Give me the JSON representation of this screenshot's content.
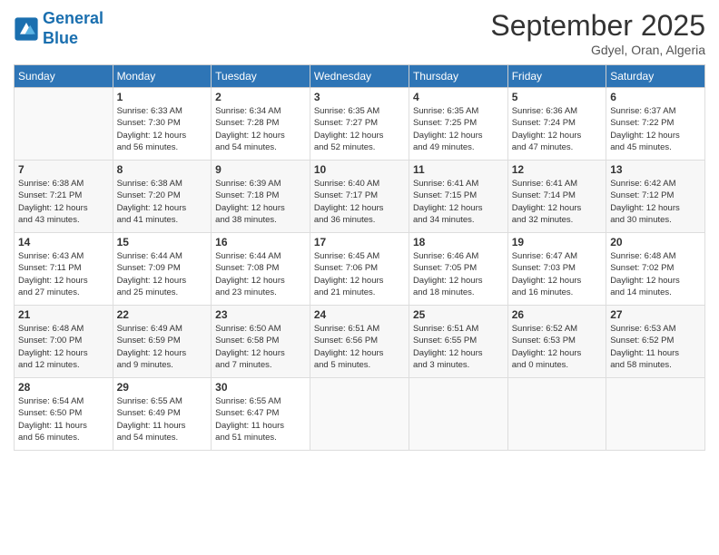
{
  "header": {
    "logo_line1": "General",
    "logo_line2": "Blue",
    "month_title": "September 2025",
    "location": "Gdyel, Oran, Algeria"
  },
  "weekdays": [
    "Sunday",
    "Monday",
    "Tuesday",
    "Wednesday",
    "Thursday",
    "Friday",
    "Saturday"
  ],
  "weeks": [
    [
      {
        "day": "",
        "info": ""
      },
      {
        "day": "1",
        "info": "Sunrise: 6:33 AM\nSunset: 7:30 PM\nDaylight: 12 hours\nand 56 minutes."
      },
      {
        "day": "2",
        "info": "Sunrise: 6:34 AM\nSunset: 7:28 PM\nDaylight: 12 hours\nand 54 minutes."
      },
      {
        "day": "3",
        "info": "Sunrise: 6:35 AM\nSunset: 7:27 PM\nDaylight: 12 hours\nand 52 minutes."
      },
      {
        "day": "4",
        "info": "Sunrise: 6:35 AM\nSunset: 7:25 PM\nDaylight: 12 hours\nand 49 minutes."
      },
      {
        "day": "5",
        "info": "Sunrise: 6:36 AM\nSunset: 7:24 PM\nDaylight: 12 hours\nand 47 minutes."
      },
      {
        "day": "6",
        "info": "Sunrise: 6:37 AM\nSunset: 7:22 PM\nDaylight: 12 hours\nand 45 minutes."
      }
    ],
    [
      {
        "day": "7",
        "info": "Sunrise: 6:38 AM\nSunset: 7:21 PM\nDaylight: 12 hours\nand 43 minutes."
      },
      {
        "day": "8",
        "info": "Sunrise: 6:38 AM\nSunset: 7:20 PM\nDaylight: 12 hours\nand 41 minutes."
      },
      {
        "day": "9",
        "info": "Sunrise: 6:39 AM\nSunset: 7:18 PM\nDaylight: 12 hours\nand 38 minutes."
      },
      {
        "day": "10",
        "info": "Sunrise: 6:40 AM\nSunset: 7:17 PM\nDaylight: 12 hours\nand 36 minutes."
      },
      {
        "day": "11",
        "info": "Sunrise: 6:41 AM\nSunset: 7:15 PM\nDaylight: 12 hours\nand 34 minutes."
      },
      {
        "day": "12",
        "info": "Sunrise: 6:41 AM\nSunset: 7:14 PM\nDaylight: 12 hours\nand 32 minutes."
      },
      {
        "day": "13",
        "info": "Sunrise: 6:42 AM\nSunset: 7:12 PM\nDaylight: 12 hours\nand 30 minutes."
      }
    ],
    [
      {
        "day": "14",
        "info": "Sunrise: 6:43 AM\nSunset: 7:11 PM\nDaylight: 12 hours\nand 27 minutes."
      },
      {
        "day": "15",
        "info": "Sunrise: 6:44 AM\nSunset: 7:09 PM\nDaylight: 12 hours\nand 25 minutes."
      },
      {
        "day": "16",
        "info": "Sunrise: 6:44 AM\nSunset: 7:08 PM\nDaylight: 12 hours\nand 23 minutes."
      },
      {
        "day": "17",
        "info": "Sunrise: 6:45 AM\nSunset: 7:06 PM\nDaylight: 12 hours\nand 21 minutes."
      },
      {
        "day": "18",
        "info": "Sunrise: 6:46 AM\nSunset: 7:05 PM\nDaylight: 12 hours\nand 18 minutes."
      },
      {
        "day": "19",
        "info": "Sunrise: 6:47 AM\nSunset: 7:03 PM\nDaylight: 12 hours\nand 16 minutes."
      },
      {
        "day": "20",
        "info": "Sunrise: 6:48 AM\nSunset: 7:02 PM\nDaylight: 12 hours\nand 14 minutes."
      }
    ],
    [
      {
        "day": "21",
        "info": "Sunrise: 6:48 AM\nSunset: 7:00 PM\nDaylight: 12 hours\nand 12 minutes."
      },
      {
        "day": "22",
        "info": "Sunrise: 6:49 AM\nSunset: 6:59 PM\nDaylight: 12 hours\nand 9 minutes."
      },
      {
        "day": "23",
        "info": "Sunrise: 6:50 AM\nSunset: 6:58 PM\nDaylight: 12 hours\nand 7 minutes."
      },
      {
        "day": "24",
        "info": "Sunrise: 6:51 AM\nSunset: 6:56 PM\nDaylight: 12 hours\nand 5 minutes."
      },
      {
        "day": "25",
        "info": "Sunrise: 6:51 AM\nSunset: 6:55 PM\nDaylight: 12 hours\nand 3 minutes."
      },
      {
        "day": "26",
        "info": "Sunrise: 6:52 AM\nSunset: 6:53 PM\nDaylight: 12 hours\nand 0 minutes."
      },
      {
        "day": "27",
        "info": "Sunrise: 6:53 AM\nSunset: 6:52 PM\nDaylight: 11 hours\nand 58 minutes."
      }
    ],
    [
      {
        "day": "28",
        "info": "Sunrise: 6:54 AM\nSunset: 6:50 PM\nDaylight: 11 hours\nand 56 minutes."
      },
      {
        "day": "29",
        "info": "Sunrise: 6:55 AM\nSunset: 6:49 PM\nDaylight: 11 hours\nand 54 minutes."
      },
      {
        "day": "30",
        "info": "Sunrise: 6:55 AM\nSunset: 6:47 PM\nDaylight: 11 hours\nand 51 minutes."
      },
      {
        "day": "",
        "info": ""
      },
      {
        "day": "",
        "info": ""
      },
      {
        "day": "",
        "info": ""
      },
      {
        "day": "",
        "info": ""
      }
    ]
  ]
}
